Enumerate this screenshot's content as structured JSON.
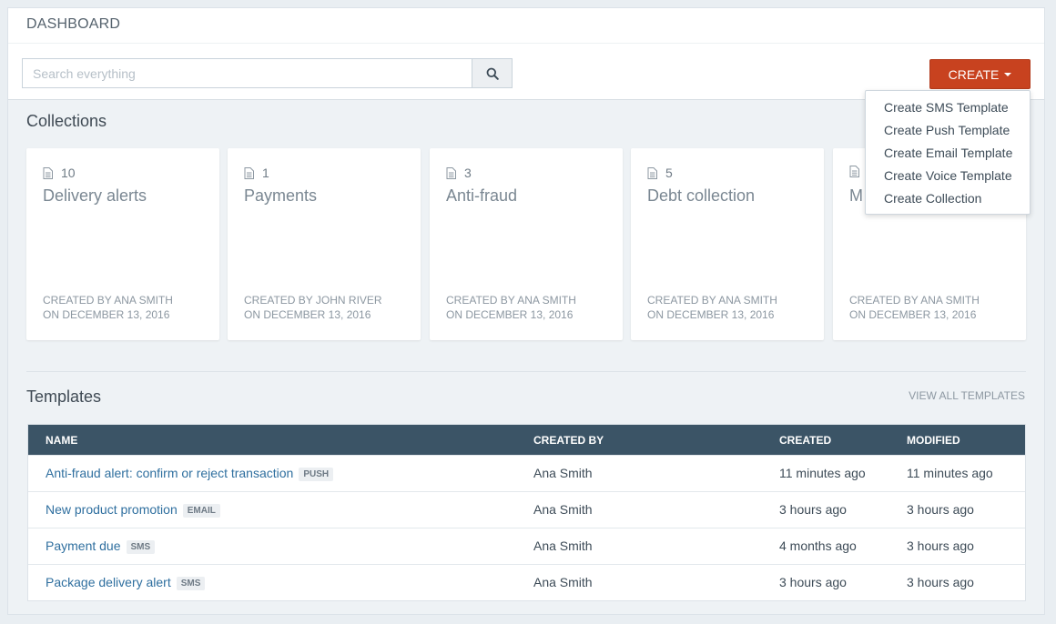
{
  "header": {
    "title": "DASHBOARD",
    "search_placeholder": "Search everything",
    "search_value": "",
    "create_label": "CREATE"
  },
  "create_menu": {
    "items": [
      {
        "label": "Create SMS Template"
      },
      {
        "label": "Create Push Template"
      },
      {
        "label": "Create Email Template"
      },
      {
        "label": "Create Voice Template"
      },
      {
        "label": "Create Collection"
      }
    ]
  },
  "collections": {
    "title": "Collections",
    "items": [
      {
        "count": "10",
        "name": "Delivery alerts",
        "created_by": "CREATED BY ANA SMITH",
        "created_on": "ON DECEMBER 13, 2016"
      },
      {
        "count": "1",
        "name": "Payments",
        "created_by": "CREATED BY JOHN RIVER",
        "created_on": "ON DECEMBER 13, 2016"
      },
      {
        "count": "3",
        "name": "Anti-fraud",
        "created_by": "CREATED BY ANA SMITH",
        "created_on": "ON DECEMBER 13, 2016"
      },
      {
        "count": "5",
        "name": "Debt collection",
        "created_by": "CREATED BY ANA SMITH",
        "created_on": "ON DECEMBER 13, 2016"
      },
      {
        "count": "",
        "name": "M",
        "created_by": "CREATED BY ANA SMITH",
        "created_on": "ON DECEMBER 13, 2016"
      }
    ]
  },
  "templates": {
    "title": "Templates",
    "view_all": "VIEW ALL TEMPLATES",
    "columns": {
      "name": "NAME",
      "created_by": "CREATED BY",
      "created": "CREATED",
      "modified": "MODIFIED"
    },
    "rows": [
      {
        "name": "Anti-fraud alert: confirm or reject transaction",
        "type": "PUSH",
        "created_by": "Ana Smith",
        "created": "11 minutes ago",
        "modified": "11 minutes ago"
      },
      {
        "name": "New product promotion",
        "type": "EMAIL",
        "created_by": "Ana Smith",
        "created": "3 hours ago",
        "modified": "3 hours ago"
      },
      {
        "name": "Payment due",
        "type": "SMS",
        "created_by": "Ana Smith",
        "created": "4 months ago",
        "modified": "3 hours ago"
      },
      {
        "name": "Package delivery alert",
        "type": "SMS",
        "created_by": "Ana Smith",
        "created": "3 hours ago",
        "modified": "3 hours ago"
      }
    ]
  },
  "icons": {
    "search": "search-icon",
    "document": "document-icon",
    "caret": "caret-down-icon"
  },
  "colors": {
    "create_button": "#c8421f",
    "table_header": "#3b5466",
    "link": "#2f6f9f",
    "page_bg": "#eef2f5"
  }
}
